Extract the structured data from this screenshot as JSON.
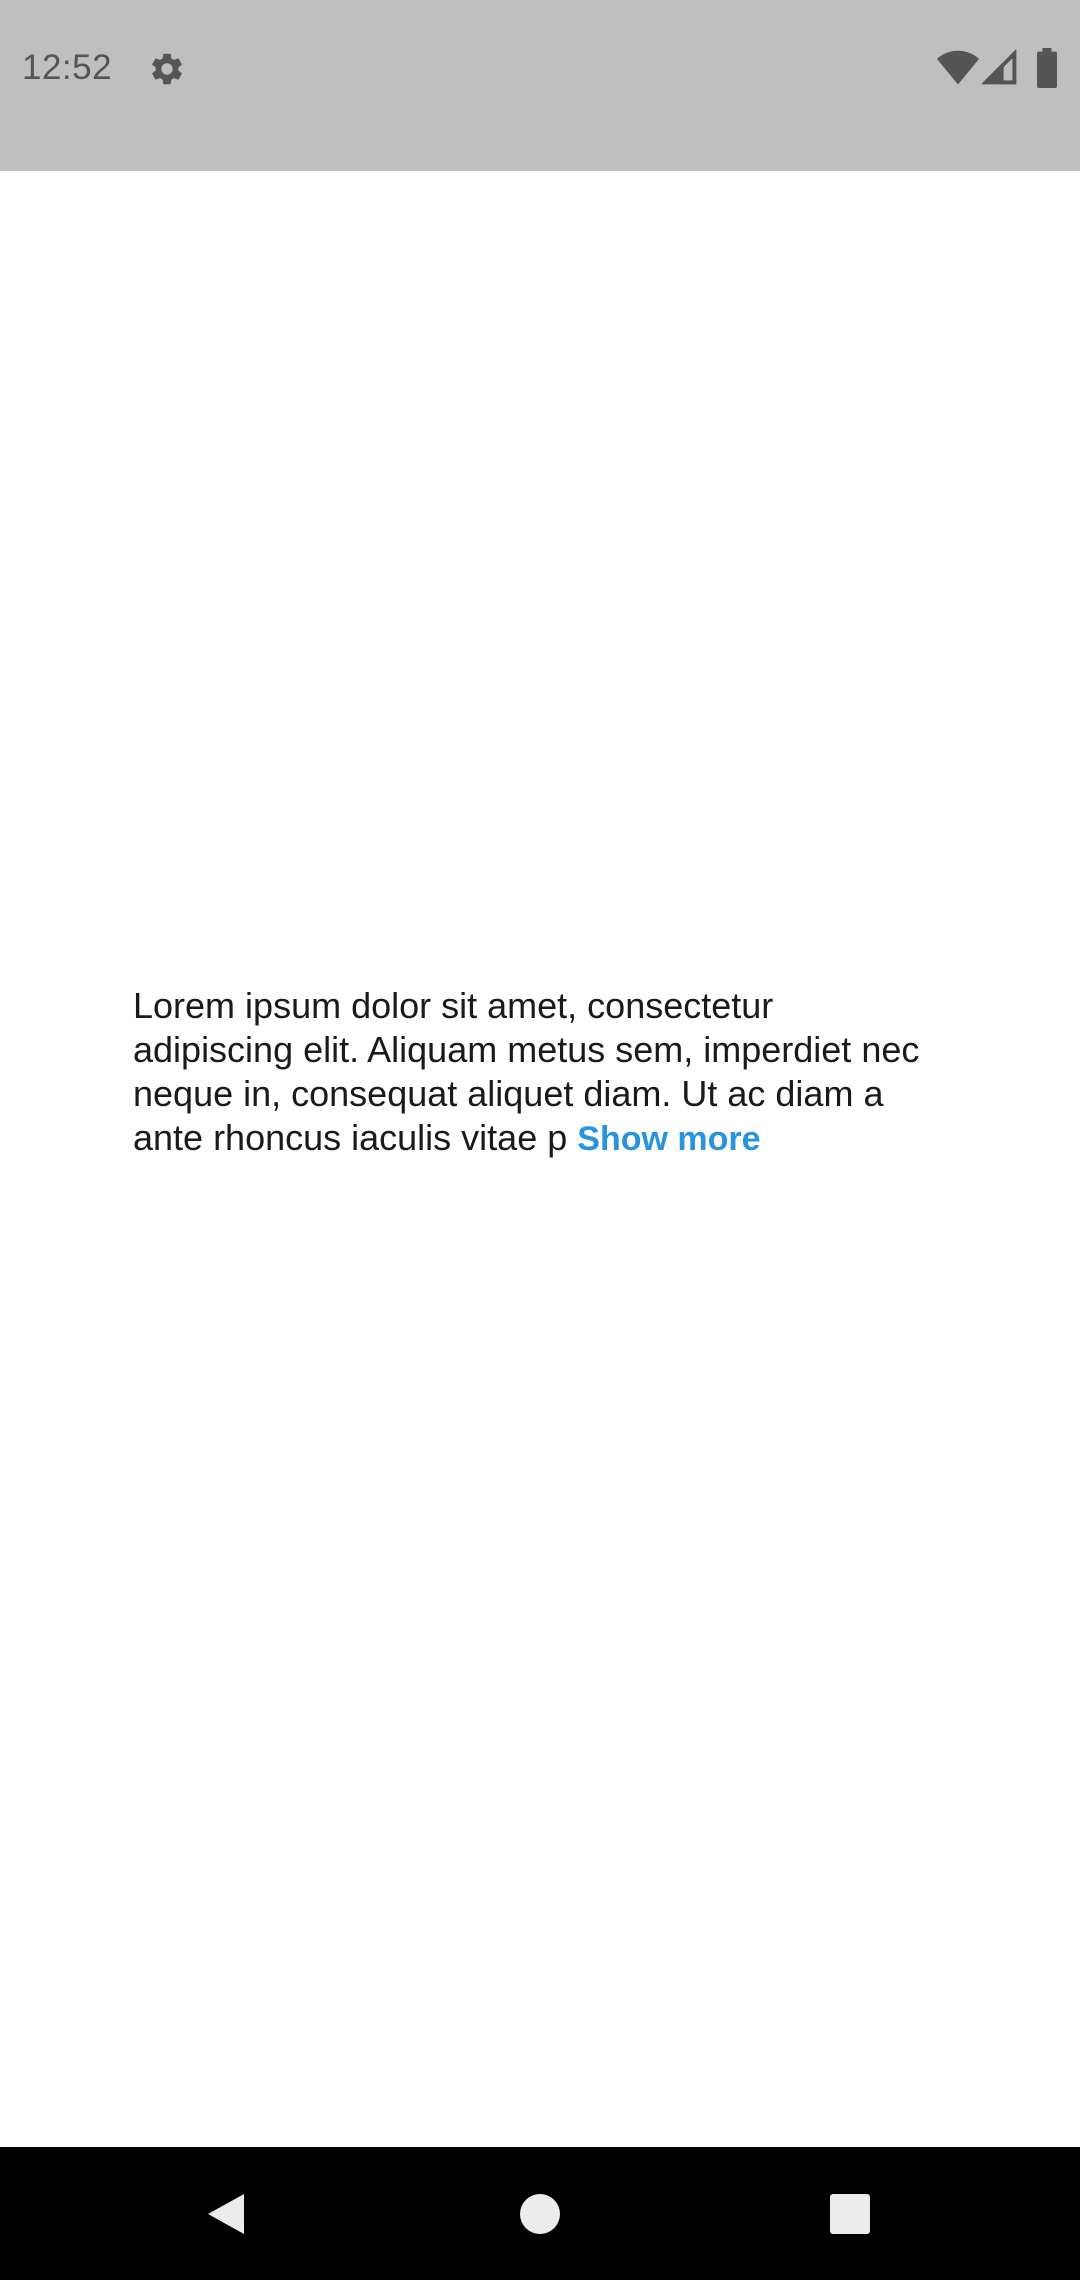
{
  "status_bar": {
    "time": "12:52",
    "icons": [
      "gear-icon",
      "wifi-icon",
      "signal-icon",
      "battery-icon"
    ],
    "background": "#bfbfbf"
  },
  "main": {
    "paragraph": "Lorem ipsum dolor sit amet, consectetur adipiscing elit. Aliquam metus sem, imperdiet nec neque in, consequat aliquet diam. Ut ac diam a ante rhoncus iaculis vitae p",
    "show_more_label": "Show more",
    "link_color": "#2a93e0"
  },
  "nav_bar": {
    "icons": [
      "back-icon",
      "home-icon",
      "recents-icon"
    ]
  }
}
